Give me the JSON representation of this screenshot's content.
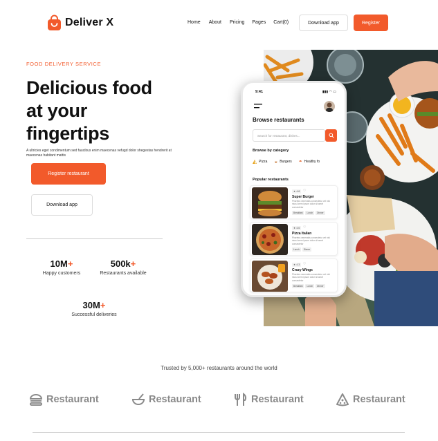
{
  "header": {
    "brand_name": "Deliver X",
    "nav": [
      "Home",
      "About",
      "Pricing",
      "Pages",
      "Cart(0)"
    ],
    "download_label": "Download app",
    "register_label": "Register"
  },
  "hero": {
    "eyebrow": "FOOD DELIVERY SERVICE",
    "headline": "Delicious food at your fingertips",
    "lead": "A ultricies eget condimentum sed faucibus enim maecenas vefugd dolor shegestas hendrerit at maecenas habitant mattis",
    "register_restaurant_label": "Register restaurant",
    "download_app_label": "Download app"
  },
  "stats": [
    {
      "value": "10M",
      "suffix": "+",
      "label": "Happy customers"
    },
    {
      "value": "500k",
      "suffix": "+",
      "label": "Restaurants available"
    },
    {
      "value": "30M",
      "suffix": "+",
      "label": "Successful deliveries"
    }
  ],
  "phone": {
    "time": "9:41",
    "status": "▮▮▮ ◠ ▭",
    "title": "Browse restaurants",
    "search_placeholder": "Search for restaurant, dishes...",
    "category_title": "Browse by category",
    "categories": [
      {
        "icon": "pizza-icon",
        "label": "Pizza"
      },
      {
        "icon": "burger-icon",
        "label": "Burgers"
      },
      {
        "icon": "bowl-icon",
        "label": "Healthy fo"
      }
    ],
    "popular_title": "Popular restaurants",
    "restaurants": [
      {
        "rating": "★ 4.8",
        "name": "Super Burger",
        "desc": "Pharetra venenatis consectetur vel nisi risus lorem ipsum dolor sit amet consectetur",
        "tags": [
          "Breakfast",
          "Lunch",
          "Dinner"
        ]
      },
      {
        "rating": "★ 4.6",
        "name": "Pizza Italian",
        "desc": "Pharetra venenatis consectetur vel nisi risus lorem ipsum dolor sit amet consectetur",
        "tags": [
          "Lunch",
          "Dinner"
        ]
      },
      {
        "rating": "★ 4.3",
        "name": "Crazy Wings",
        "desc": "Pharetra venenatis consectetur vel nisi risus lorem ipsum dolor sit amet consectetur",
        "tags": [
          "Breakfast",
          "Lunch",
          "Dinner"
        ]
      }
    ]
  },
  "trusted": {
    "text": "Trusted by 5,000+ restaurants around the world",
    "logos": [
      {
        "icon": "burger-logo-icon",
        "label": "Restaurant"
      },
      {
        "icon": "bowl-logo-icon",
        "label": "Restaurant"
      },
      {
        "icon": "fork-knife-logo-icon",
        "label": "Restaurant"
      },
      {
        "icon": "pizza-logo-icon",
        "label": "Restaurant"
      }
    ]
  },
  "colors": {
    "accent": "#f25a2b",
    "text": "#111111",
    "logo_gray": "#8a8a8a"
  }
}
